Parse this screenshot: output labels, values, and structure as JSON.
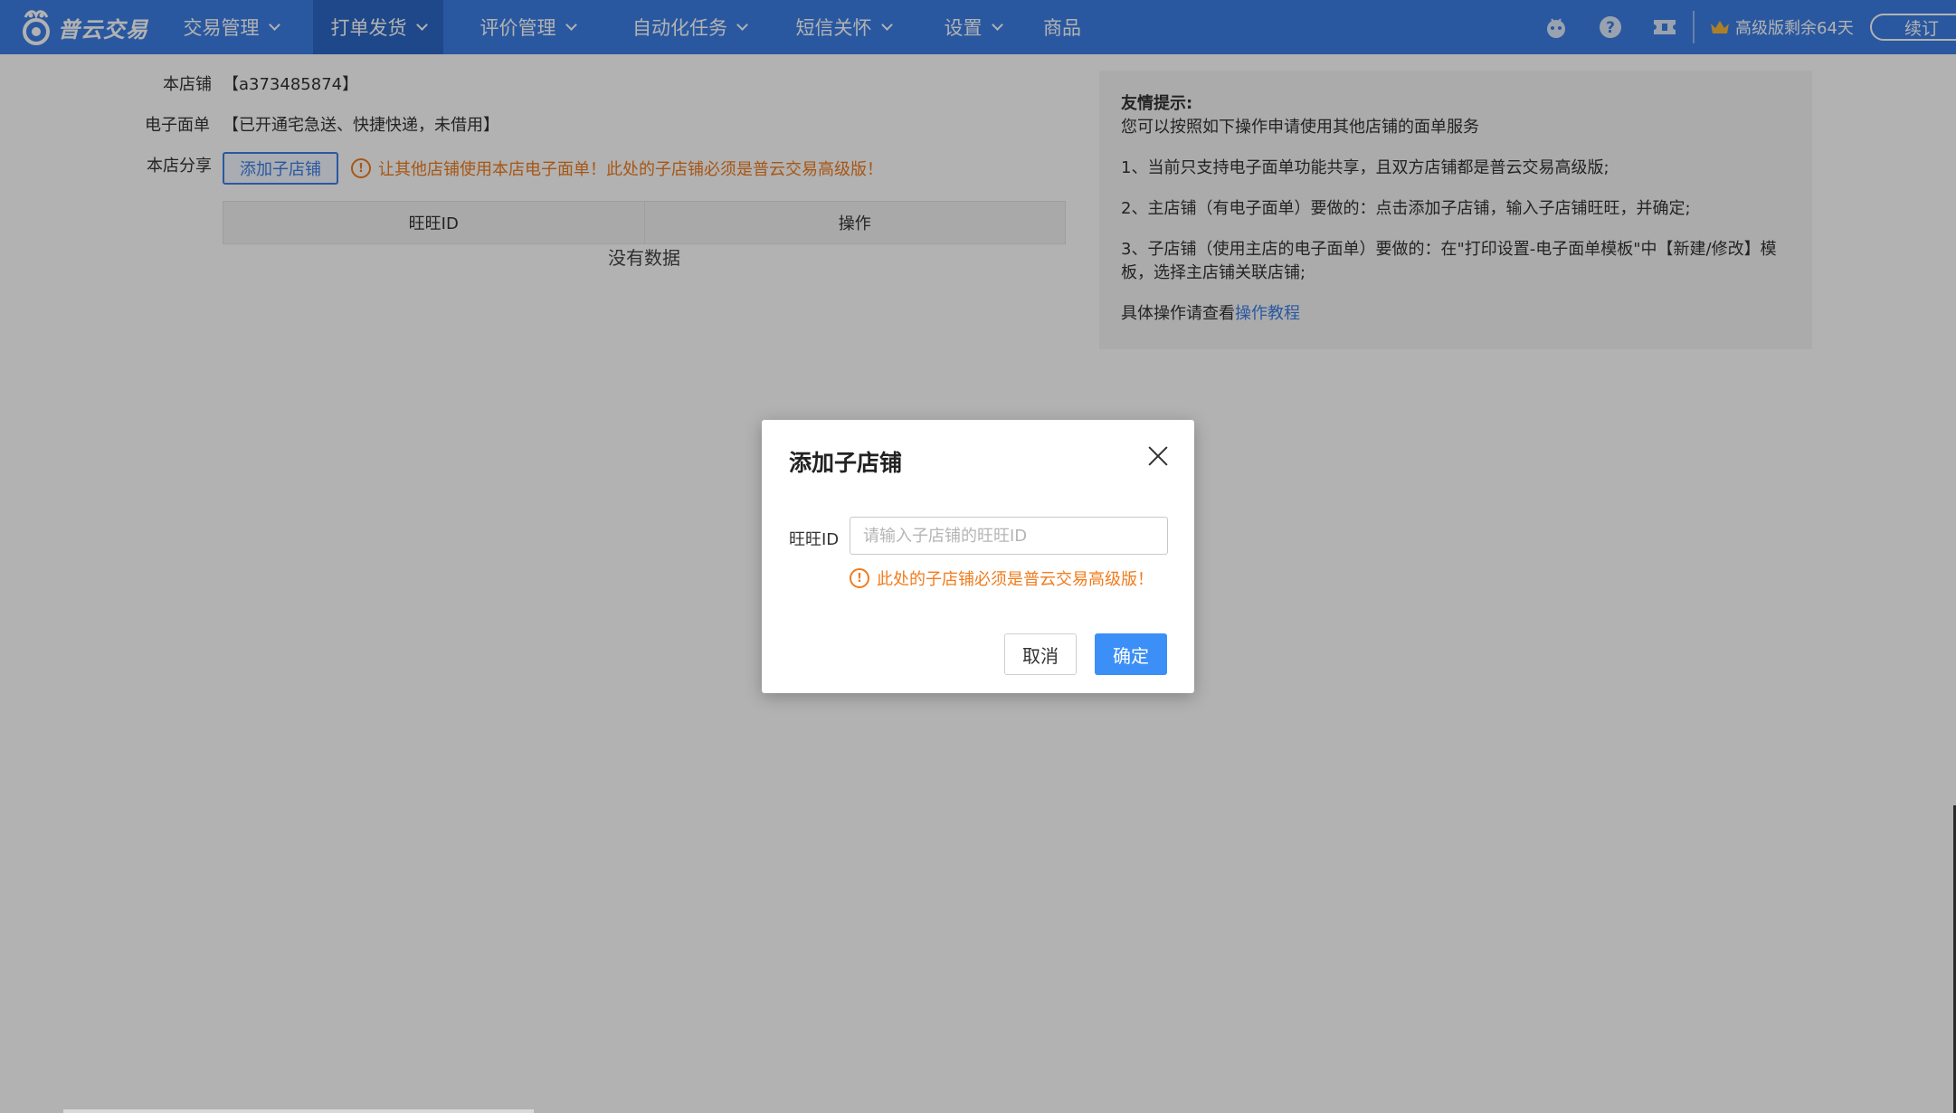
{
  "app": {
    "logo_text": "普云交易"
  },
  "nav": {
    "items": [
      {
        "label": "交易管理"
      },
      {
        "label": "打单发货"
      },
      {
        "label": "评价管理"
      },
      {
        "label": "自动化任务"
      },
      {
        "label": "短信关怀"
      },
      {
        "label": "设置"
      },
      {
        "label": "商品"
      }
    ],
    "active_index": 1,
    "vip_text": "高级版剩余64天",
    "renew_label": "续订",
    "icons": [
      "robot-icon",
      "help-icon",
      "ticket-icon",
      "crown-icon"
    ]
  },
  "store": {
    "store_label": "本店铺",
    "store_value": "【a373485874】",
    "waybill_label": "电子面单",
    "waybill_value": "【已开通宅急送、快捷快递，未借用】",
    "share_label": "本店分享",
    "add_button": "添加子店铺",
    "share_warning": "让其他店铺使用本店电子面单！此处的子店铺必须是普云交易高级版！"
  },
  "table": {
    "columns": [
      "旺旺ID",
      "操作"
    ],
    "rows": [],
    "empty_text": "没有数据"
  },
  "tips": {
    "title": "友情提示:",
    "intro": "您可以按照如下操作申请使用其他店铺的面单服务",
    "step1": "1、当前只支持电子面单功能共享，且双方店铺都是普云交易高级版;",
    "step2": "2、主店铺（有电子面单）要做的：点击添加子店铺，输入子店铺旺旺，并确定;",
    "step3": "3、子店铺（使用主店的电子面单）要做的：在\"打印设置-电子面单模板\"中【新建/修改】模板，选择主店铺关联店铺;",
    "more_prefix": "具体操作请查看",
    "more_link": "操作教程"
  },
  "modal": {
    "title": "添加子店铺",
    "field_label": "旺旺ID",
    "field_value": "",
    "field_placeholder": "请输入子店铺的旺旺ID",
    "warning": "此处的子店铺必须是普云交易高级版！",
    "cancel_label": "取消",
    "ok_label": "确定"
  },
  "colors": {
    "brand": "#3b7fe6",
    "nav_active": "#2c68c5",
    "warning": "#f07c1e",
    "primary_button": "#3b8ff6"
  }
}
